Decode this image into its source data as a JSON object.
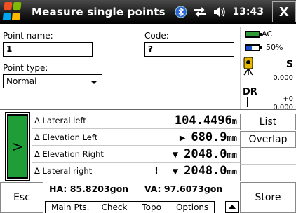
{
  "titlebar": {
    "title": "Measure single points",
    "time": "13:43",
    "close_label": "X",
    "icons": [
      "windows-logo-icon",
      "bluetooth-icon",
      "connectivity-icon",
      "speaker-icon"
    ]
  },
  "form": {
    "point_name_label": "Point name:",
    "point_name_value": "1",
    "code_label": "Code:",
    "code_value": "?",
    "point_type_label": "Point type:",
    "point_type_value": "Normal"
  },
  "status": {
    "power_label": "AC",
    "battery_label": "50%",
    "instrument_mode": "S",
    "instrument_value": "0.000",
    "dr_label": "DR",
    "dr_offset": "+0",
    "dr_value": "0.000",
    "colors": {
      "ac_battery": "#2e9b37",
      "instrument_battery": "#1a4fc9"
    }
  },
  "measurements": [
    {
      "name": "Δ Lateral left",
      "prefix": "",
      "value": "104.4496",
      "unit": "m",
      "flag": ""
    },
    {
      "name": "Δ Elevation Left",
      "prefix": "▶",
      "value": "680.9",
      "unit": "mm",
      "flag": ""
    },
    {
      "name": "Δ Elevation Right",
      "prefix": "▼",
      "value": "2048.0",
      "unit": "mm",
      "flag": ""
    },
    {
      "name": "Δ Lateral right",
      "prefix": "▼",
      "value": "2048.0",
      "unit": "mm",
      "flag": "!"
    }
  ],
  "side_buttons": {
    "list": "List",
    "overlap": "Overlap"
  },
  "bottom": {
    "esc": "Esc",
    "store": "Store",
    "ha": "HA: 85.8203gon",
    "va": "VA: 97.6073gon",
    "tabs": [
      "Main Pts.",
      "Check",
      "Topo",
      "Options"
    ]
  },
  "accent": {
    "green": "#1f9d36"
  }
}
